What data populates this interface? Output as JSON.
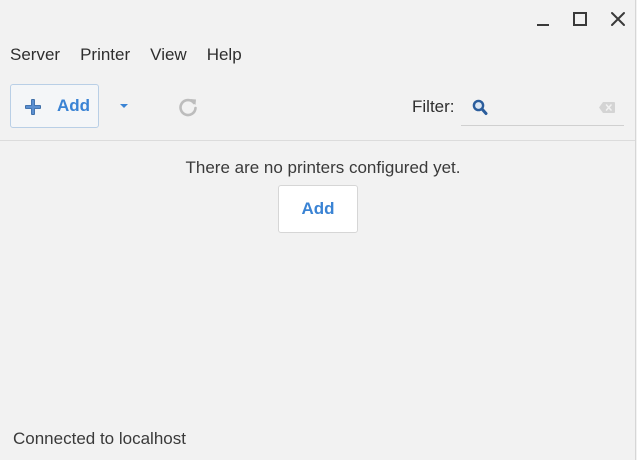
{
  "menubar": {
    "items": [
      "Server",
      "Printer",
      "View",
      "Help"
    ]
  },
  "toolbar": {
    "add_label": "Add",
    "filter_label": "Filter:",
    "filter_value": "",
    "filter_placeholder": ""
  },
  "content": {
    "empty_message": "There are no printers configured yet.",
    "add_button_label": "Add"
  },
  "statusbar": {
    "text": "Connected to localhost"
  },
  "colors": {
    "accent": "#3a83d4",
    "background": "#f2f2f2",
    "text": "#2e2e2e"
  },
  "icons": {
    "minimize": "minimize-icon",
    "maximize": "maximize-icon",
    "close": "close-icon",
    "add": "plus-icon",
    "dropdown": "chevron-down-icon",
    "refresh": "refresh-icon",
    "search": "search-icon",
    "clear": "clear-icon"
  }
}
